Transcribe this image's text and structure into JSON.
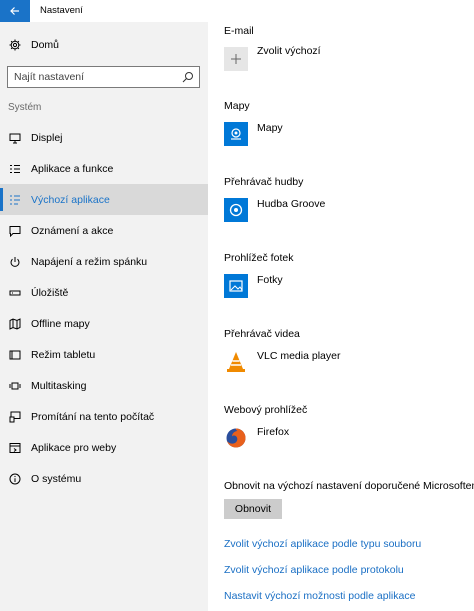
{
  "window": {
    "title": "Nastavení"
  },
  "sidebar": {
    "home_label": "Domů",
    "search": {
      "placeholder": "Najít nastavení",
      "value": ""
    },
    "section_label": "Systém",
    "items": [
      {
        "label": "Displej",
        "icon": "display-icon"
      },
      {
        "label": "Aplikace a funkce",
        "icon": "apps-list-icon"
      },
      {
        "label": "Výchozí aplikace",
        "icon": "default-apps-icon",
        "active": true
      },
      {
        "label": "Oznámení a akce",
        "icon": "notification-icon"
      },
      {
        "label": "Napájení a režim spánku",
        "icon": "power-icon"
      },
      {
        "label": "Úložiště",
        "icon": "storage-icon"
      },
      {
        "label": "Offline mapy",
        "icon": "map-icon"
      },
      {
        "label": "Režim tabletu",
        "icon": "tablet-icon"
      },
      {
        "label": "Multitasking",
        "icon": "multitasking-icon"
      },
      {
        "label": "Promítání na tento počítač",
        "icon": "projecting-icon"
      },
      {
        "label": "Aplikace pro weby",
        "icon": "web-apps-icon"
      },
      {
        "label": "O systému",
        "icon": "info-icon"
      }
    ]
  },
  "main": {
    "groups": [
      {
        "heading": "E-mail",
        "app": "Zvolit výchozí",
        "icon": "plus-icon"
      },
      {
        "heading": "Mapy",
        "app": "Mapy",
        "icon": "maps-app-icon"
      },
      {
        "heading": "Přehrávač hudby",
        "app": "Hudba Groove",
        "icon": "groove-music-icon"
      },
      {
        "heading": "Prohlížeč fotek",
        "app": "Fotky",
        "icon": "photos-app-icon"
      },
      {
        "heading": "Přehrávač videa",
        "app": "VLC media player",
        "icon": "vlc-icon"
      },
      {
        "heading": "Webový prohlížeč",
        "app": "Firefox",
        "icon": "firefox-icon"
      }
    ],
    "reset_text": "Obnovit na výchozí nastavení doporučené Microsoftem",
    "reset_button": "Obnovit",
    "links": [
      "Zvolit výchozí aplikace podle typu souboru",
      "Zvolit výchozí aplikace podle protokolu",
      "Nastavit výchozí možnosti podle aplikace"
    ]
  },
  "colors": {
    "accent": "#1a73c8",
    "link": "#1a6fc4",
    "sidebar_bg": "#f2f2f2",
    "tile_blue": "#0078d7"
  }
}
